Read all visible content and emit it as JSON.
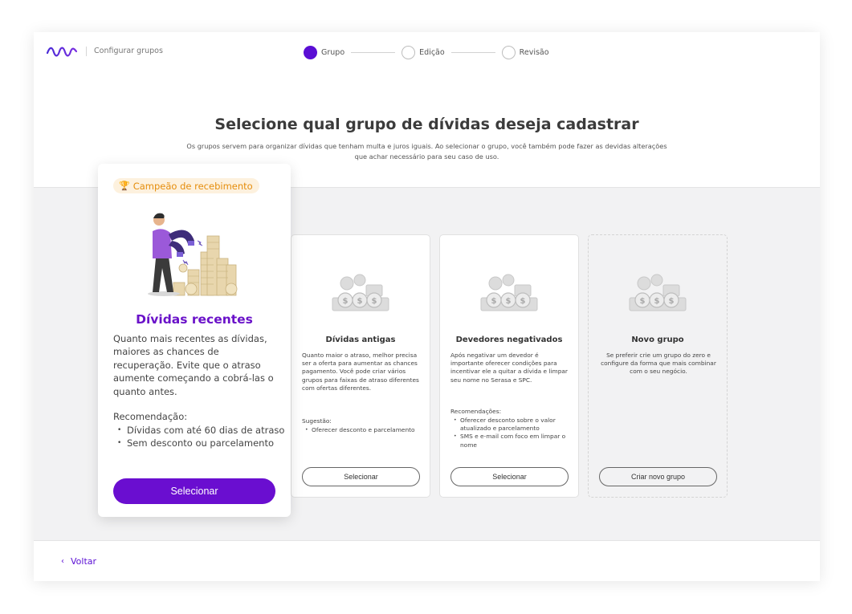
{
  "header": {
    "breadcrumb": "Configurar grupos",
    "steps": [
      {
        "label": "Grupo",
        "active": true
      },
      {
        "label": "Edição",
        "active": false
      },
      {
        "label": "Revisão",
        "active": false
      }
    ]
  },
  "intro": {
    "title": "Selecione qual grupo de dívidas deseja cadastrar",
    "subtitle": "Os grupos servem para organizar dívidas que tenham multa e juros iguais. Ao selecionar o grupo, você também pode fazer as devidas alterações que achar necessário para seu caso de uso."
  },
  "featured": {
    "badge": "Campeão de recebimento",
    "title": "Dívidas recentes",
    "description": "Quanto mais recentes as dívidas, maiores as chances de recuperação. Evite que o atraso aumente começando a cobrá-las o quanto antes.",
    "rec_label": "Recomendação:",
    "rec_items": [
      "Dívidas com até 60 dias de atraso",
      "Sem desconto ou parcelamento"
    ],
    "button": "Selecionar"
  },
  "cards": [
    {
      "title": "Dívidas antigas",
      "description": "Quanto maior o atraso, melhor precisa ser a oferta para aumentar as chances pagamento. Você pode criar vários grupos para faixas de atraso diferentes com ofertas diferentes.",
      "sub_label": "Sugestão:",
      "items": [
        "Oferecer desconto e parcelamento"
      ],
      "button": "Selecionar"
    },
    {
      "title": "Devedores negativados",
      "description": "Após negativar um devedor é importante oferecer condições para incentivar ele a quitar a dívida e limpar seu nome no Serasa e SPC.",
      "sub_label": "Recomendações:",
      "items": [
        "Oferecer desconto sobre o valor atualizado e parcelamento",
        "SMS e e-mail com foco em limpar o nome"
      ],
      "button": "Selecionar"
    },
    {
      "title": "Novo grupo",
      "description": "Se preferir crie um grupo do zero e configure da forma que mais combinar com o seu negócio.",
      "button": "Criar novo grupo"
    }
  ],
  "footer": {
    "back": "Voltar"
  },
  "colors": {
    "brand": "#5a0ed4",
    "badge_text": "#e58d0c",
    "badge_bg": "#fdf1de"
  }
}
